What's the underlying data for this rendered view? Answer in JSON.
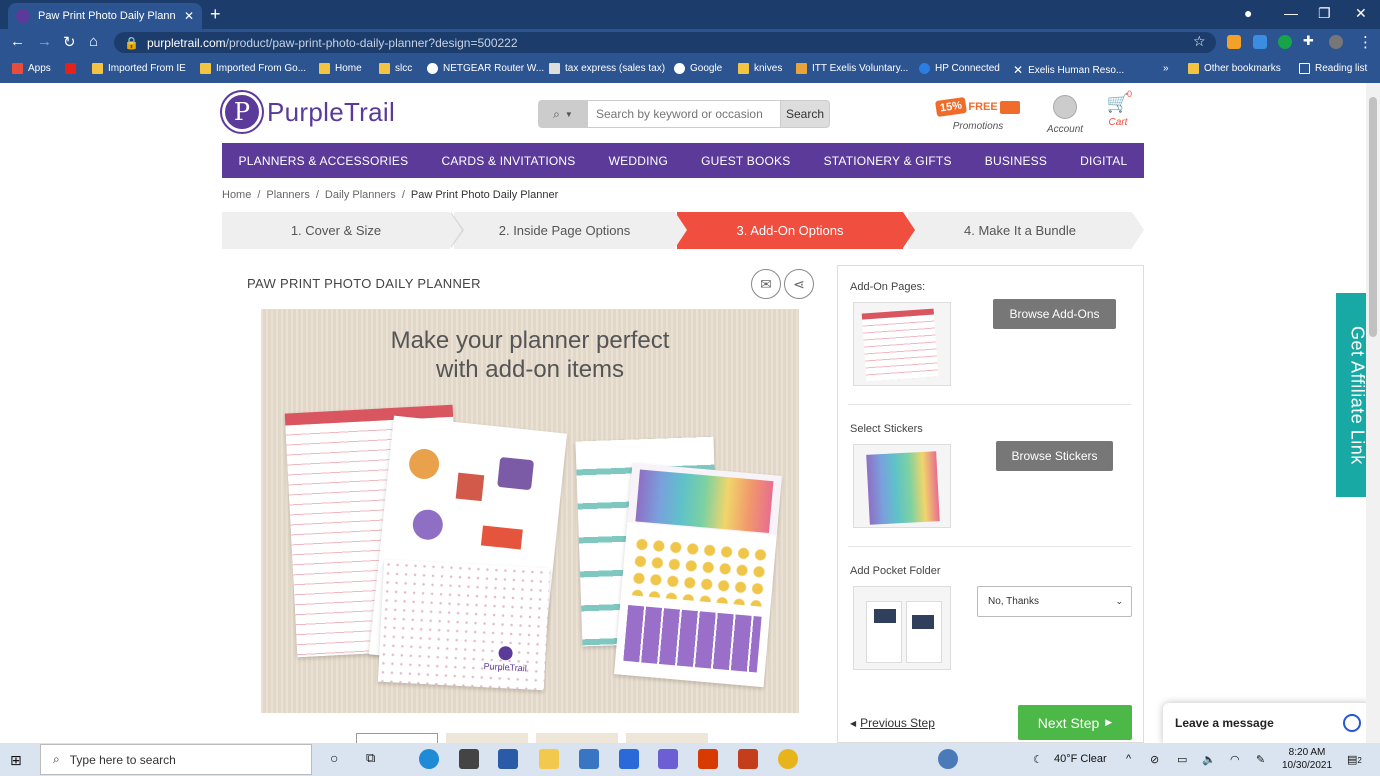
{
  "browser": {
    "tab_title": "Paw Print Photo Daily Planner | D",
    "url_host": "purpletrail.com",
    "url_path": "/product/paw-print-photo-daily-planner?design=500222",
    "bookmarks": [
      "Apps",
      "Imported From IE",
      "Imported From Go...",
      "Home",
      "slcc",
      "NETGEAR Router W...",
      "tax express (sales tax)",
      "Google",
      "knives",
      "ITT Exelis Voluntary...",
      "HP Connected",
      "Exelis Human Reso..."
    ],
    "other_bookmarks": "Other bookmarks",
    "reading_list": "Reading list",
    "overflow": "»"
  },
  "header": {
    "brand": "PurpleTrail",
    "search_placeholder": "Search by keyword or occasion",
    "search_button": "Search",
    "promo_badge": "15%",
    "promo_free": "FREE",
    "promo_label": "Promotions",
    "account_label": "Account",
    "cart_label": "Cart",
    "cart_count": "0"
  },
  "nav": [
    "PLANNERS & ACCESSORIES",
    "CARDS & INVITATIONS",
    "WEDDING",
    "GUEST BOOKS",
    "STATIONERY & GIFTS",
    "BUSINESS",
    "DIGITAL"
  ],
  "breadcrumbs": [
    "Home",
    "Planners",
    "Daily Planners",
    "Paw Print Photo Daily Planner"
  ],
  "steps": [
    {
      "label": "1. Cover & Size",
      "active": false
    },
    {
      "label": "2. Inside Page Options",
      "active": false
    },
    {
      "label": "3. Add-On Options",
      "active": true
    },
    {
      "label": "4. Make It a Bundle",
      "active": false
    }
  ],
  "product": {
    "title": "PAW PRINT PHOTO DAILY PLANNER",
    "hero_line1": "Make your planner perfect",
    "hero_line2": "with add-on items",
    "hero_brand": "PurpleTrail"
  },
  "addons": {
    "pages_label": "Add-On Pages:",
    "pages_button": "Browse Add-Ons",
    "stickers_label": "Select Stickers",
    "stickers_button": "Browse Stickers",
    "pocket_label": "Add Pocket Folder",
    "pocket_value": "No, Thanks",
    "prev_label": "Previous Step",
    "next_label": "Next Step"
  },
  "affiliate": "Get Affiliate Link",
  "chat": "Leave a message",
  "taskbar": {
    "search_placeholder": "Type here to search",
    "weather": "40°F  Clear",
    "time": "8:20 AM",
    "date": "10/30/2021",
    "notifications": "2"
  },
  "colors": {
    "brand_purple": "#5b3a9a",
    "step_active": "#f04e3e",
    "next_green": "#4cb848",
    "affiliate_teal": "#19a9a5",
    "browser_blue": "#2c5490"
  }
}
